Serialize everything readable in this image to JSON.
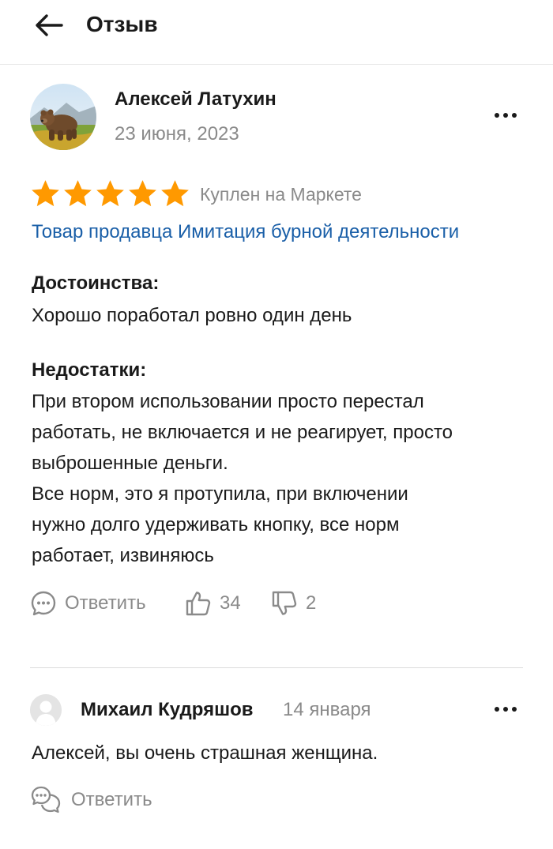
{
  "header": {
    "title": "Отзыв"
  },
  "review": {
    "author": "Алексей Латухин",
    "date": "23 июня, 2023",
    "rating": 5,
    "rating_max": 5,
    "star_color": "#ff9900",
    "purchased_label": "Куплен на Маркете",
    "product_link": "Товар продавца Имитация бурной деятельности",
    "pros_title": "Достоинства:",
    "pros_text": "Хорошо поработал ровно один день",
    "cons_title": "Недостатки:",
    "cons_lines": [
      "При втором использовании просто перестал",
      "работать, не включается и не реагирует, просто",
      "выброшенные деньги.",
      "Все норм, это я протупила, при включении",
      "нужно долго удерживать кнопку, все норм",
      "работает, извиняюсь"
    ],
    "reply_label": "Ответить",
    "likes": "34",
    "dislikes": "2"
  },
  "comment": {
    "author": "Михаил Кудряшов",
    "date": "14 января",
    "text": "Алексей, вы очень страшная женщина.",
    "reply_label": "Ответить"
  },
  "colors": {
    "accent_link": "#1a5fa8",
    "muted_text": "#8a8a8a",
    "star": "#ff9900"
  }
}
